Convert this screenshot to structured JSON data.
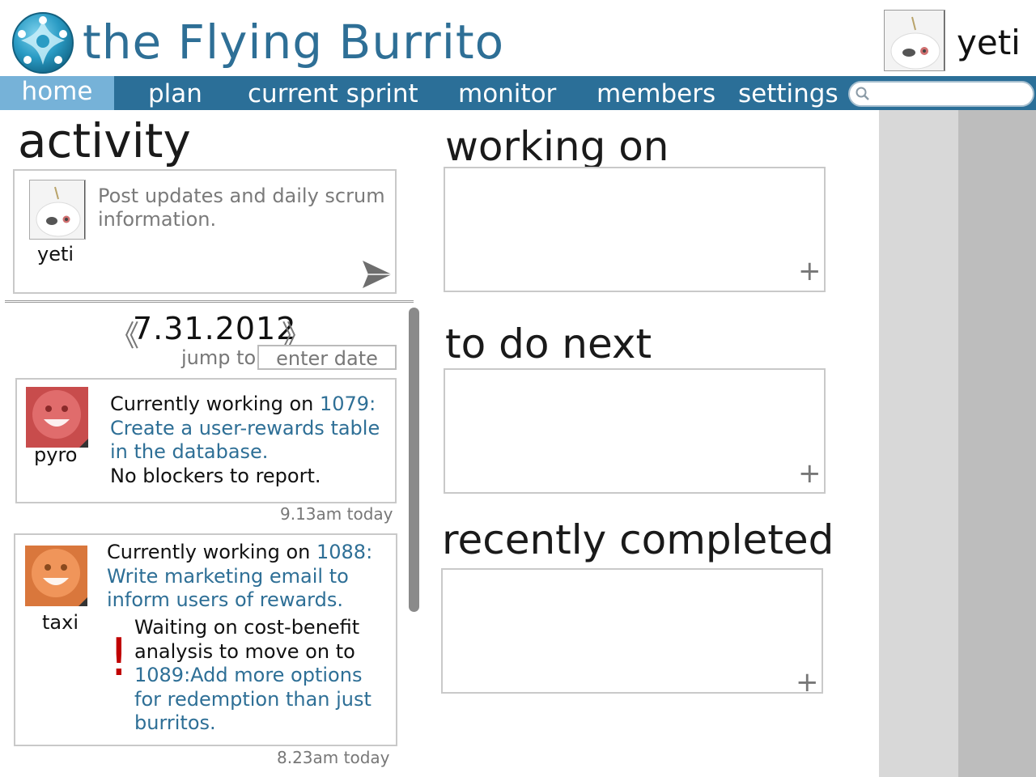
{
  "header": {
    "app_title": "the Flying Burrito",
    "logo_icon": "burrito-logo-icon",
    "user_name": "yeti",
    "user_avatar": "yeti-avatar-icon"
  },
  "nav": {
    "items": [
      {
        "label": "home",
        "active": true
      },
      {
        "label": "plan"
      },
      {
        "label": "current sprint"
      },
      {
        "label": "monitor"
      },
      {
        "label": "members"
      },
      {
        "label": "settings"
      }
    ],
    "search_placeholder": "",
    "search_icon": "search-icon"
  },
  "activity": {
    "title": "activity",
    "post": {
      "user": "yeti",
      "placeholder": "Post updates and daily scrum information.",
      "send_icon": "send-icon"
    },
    "date": {
      "prev": "《",
      "value": "7.31.2012",
      "next": "》",
      "jump_label": "jump to",
      "input_placeholder": "enter date"
    },
    "feed": [
      {
        "user": "pyro",
        "avatar_color": "#d45a5a",
        "text_prefix": "Currently working on ",
        "task_link": "1079: Create a user-rewards table in the database.",
        "status": "No blockers to report.",
        "timestamp": "9.13am today"
      },
      {
        "user": "taxi",
        "avatar_color": "#e0844a",
        "text_prefix": "Currently working on ",
        "task_link": "1088: Write marketing email to inform users of  rewards.",
        "blocker_mark": "!",
        "blocker_text": "Waiting on cost-benefit analysis to move on to ",
        "blocker_link": "1089:Add more options for redemption than just burritos.",
        "timestamp": "8.23am today"
      }
    ]
  },
  "sections": {
    "working_on": {
      "title": "working on",
      "add": "+"
    },
    "to_do_next": {
      "title": "to do next",
      "add": "+"
    },
    "recently_completed": {
      "title": "recently completed",
      "add": "+"
    }
  },
  "colors": {
    "brand": "#2e6f96",
    "nav_bg": "#2b6f98",
    "nav_active": "#76b2d8",
    "blocker": "#c00000"
  }
}
